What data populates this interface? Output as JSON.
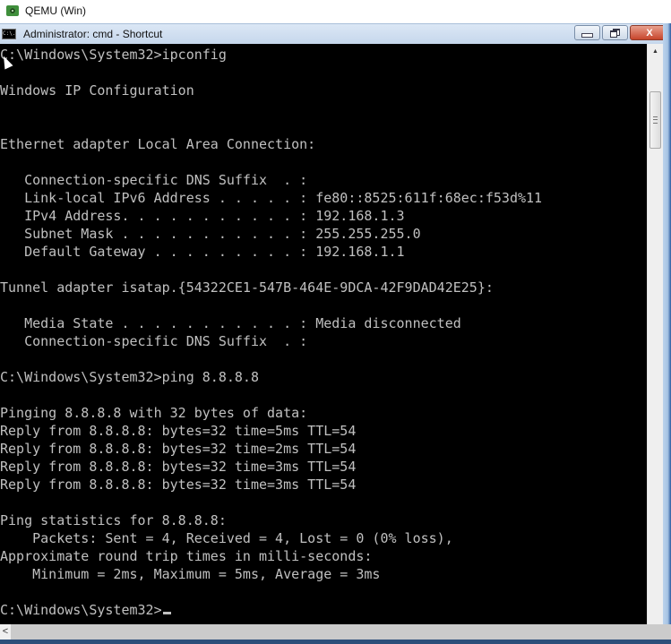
{
  "host_window": {
    "title": "QEMU (Win)",
    "icon": "qemu-eye-icon"
  },
  "cmd_window": {
    "title": "Administrator: cmd - Shortcut",
    "icon": "cmd-console-icon",
    "icon_text": "C:\\.",
    "buttons": {
      "minimize": "minimize-icon",
      "restore": "restore-icon",
      "close": "close-icon",
      "close_glyph": "X"
    }
  },
  "console": {
    "colors": {
      "background": "#000000",
      "foreground": "#c0c0c0"
    },
    "lines": [
      "C:\\Windows\\System32>ipconfig",
      "",
      "Windows IP Configuration",
      "",
      "",
      "Ethernet adapter Local Area Connection:",
      "",
      "   Connection-specific DNS Suffix  . :",
      "   Link-local IPv6 Address . . . . . : fe80::8525:611f:68ec:f53d%11",
      "   IPv4 Address. . . . . . . . . . . : 192.168.1.3",
      "   Subnet Mask . . . . . . . . . . . : 255.255.255.0",
      "   Default Gateway . . . . . . . . . : 192.168.1.1",
      "",
      "Tunnel adapter isatap.{54322CE1-547B-464E-9DCA-42F9DAD42E25}:",
      "",
      "   Media State . . . . . . . . . . . : Media disconnected",
      "   Connection-specific DNS Suffix  . :",
      "",
      "C:\\Windows\\System32>ping 8.8.8.8",
      "",
      "Pinging 8.8.8.8 with 32 bytes of data:",
      "Reply from 8.8.8.8: bytes=32 time=5ms TTL=54",
      "Reply from 8.8.8.8: bytes=32 time=2ms TTL=54",
      "Reply from 8.8.8.8: bytes=32 time=3ms TTL=54",
      "Reply from 8.8.8.8: bytes=32 time=3ms TTL=54",
      "",
      "Ping statistics for 8.8.8.8:",
      "    Packets: Sent = 4, Received = 4, Lost = 0 (0% loss),",
      "Approximate round trip times in milli-seconds:",
      "    Minimum = 2ms, Maximum = 5ms, Average = 3ms",
      "",
      "C:\\Windows\\System32>"
    ]
  },
  "scrollbars": {
    "vertical_up_glyph": "▲",
    "horizontal_left_glyph": "<"
  }
}
